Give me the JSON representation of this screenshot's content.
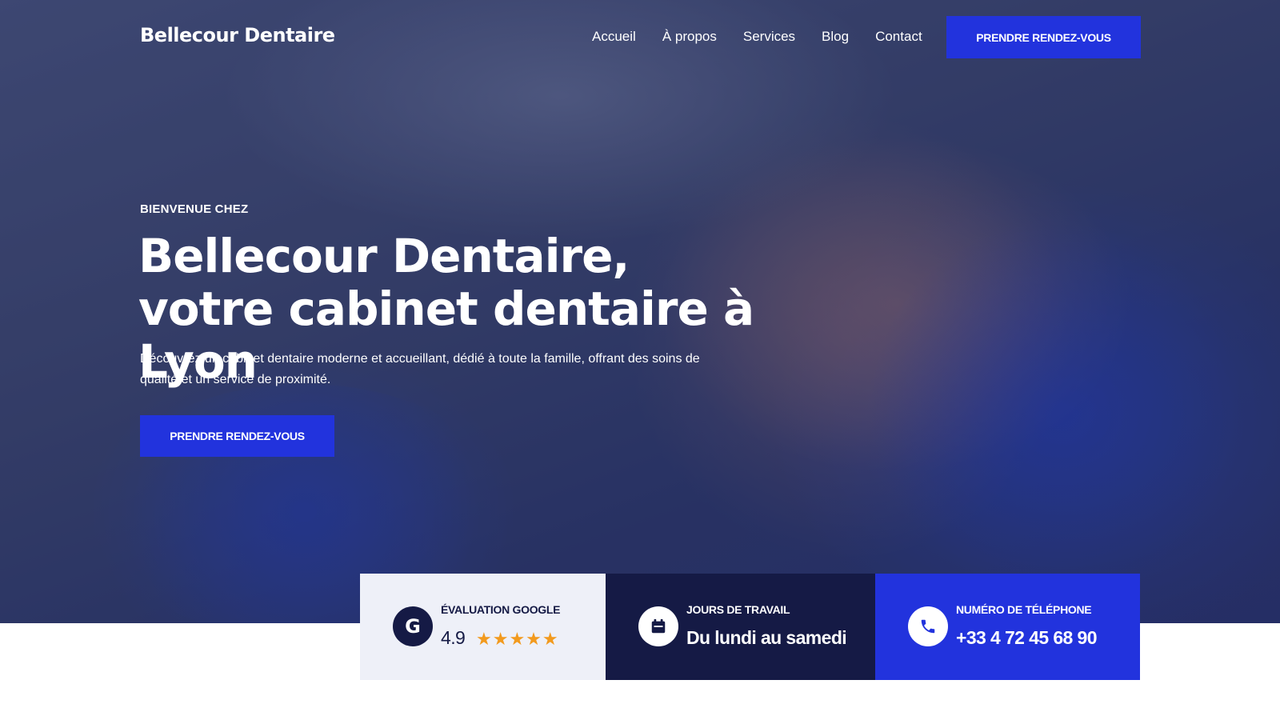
{
  "brand": {
    "name": "Bellecour Dentaire"
  },
  "nav": {
    "items": [
      {
        "label": "Accueil"
      },
      {
        "label": "À propos"
      },
      {
        "label": "Services"
      },
      {
        "label": "Blog"
      },
      {
        "label": "Contact"
      }
    ],
    "cta_label": "PRENDRE RENDEZ-VOUS"
  },
  "hero": {
    "eyebrow": "BIENVENUE CHEZ",
    "headline": "Bellecour Dentaire, votre cabinet dentaire à Lyon",
    "lede": "Découvrez un cabinet dentaire moderne et accueillant, dédié à toute la famille, offrant des soins de qualité et un service de proximité.",
    "cta_label": "PRENDRE RENDEZ-VOUS"
  },
  "info": {
    "rating": {
      "label": "ÉVALUATION GOOGLE",
      "value": "4.9",
      "stars": "★★★★★",
      "icon_letter": "G",
      "icon": "google-icon",
      "star_count": 5
    },
    "hours": {
      "label": "JOURS DE TRAVAIL",
      "value": "Du lundi au samedi",
      "icon": "calendar-icon"
    },
    "phone": {
      "label": "NUMÉRO DE TÉLÉPHONE",
      "value": "+33 4 72 45 68 90",
      "icon": "phone-icon"
    }
  },
  "colors": {
    "accent": "#2233dd",
    "navy": "#151a45",
    "light_card": "#eef0f8",
    "star": "#f29a1e"
  }
}
